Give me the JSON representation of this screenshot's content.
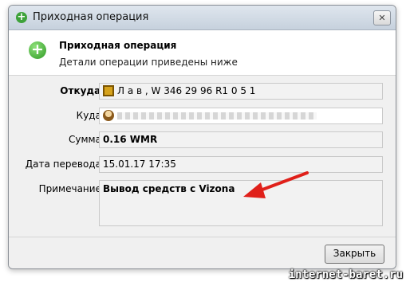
{
  "window": {
    "title": "Приходная операция",
    "close_label": "✕"
  },
  "header": {
    "title": "Приходная операция",
    "subtitle": "Детали операции приведены ниже"
  },
  "fields": {
    "from_label": "Откуда:",
    "from_value": "Л а в , W      346  29   96    R1  0    5 1",
    "to_label": "Куда:",
    "to_value": "",
    "amount_label": "Сумма:",
    "amount_value": "0.16 WMR",
    "date_label": "Дата перевода:",
    "date_value": "15.01.17 17:35",
    "note_label": "Примечание:",
    "note_value": "Вывод средств с Vizona"
  },
  "footer": {
    "close_button": "Закрыть"
  },
  "watermark": "internet-baret.ru",
  "colors": {
    "arrow": "#e0201a",
    "accent_green": "#3ea23a"
  }
}
